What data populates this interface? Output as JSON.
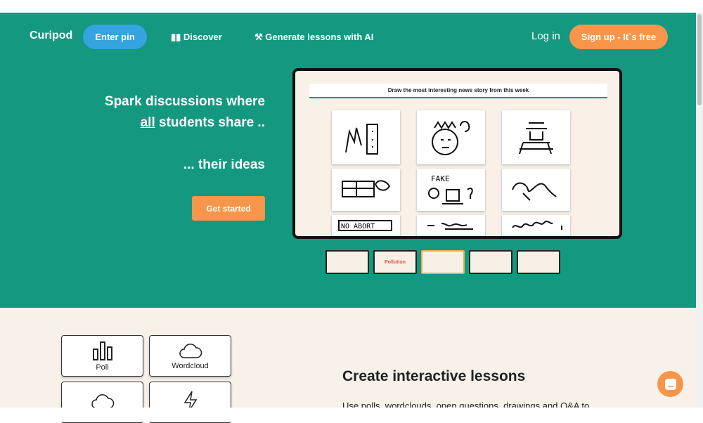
{
  "nav": {
    "logo": "Curipod",
    "enter_pin": "Enter pin",
    "discover": "Discover",
    "generate": "Generate lessons with AI",
    "login": "Log in",
    "signup": "Sign up - It`s free"
  },
  "hero": {
    "line1": "Spark discussions where",
    "line2_em": "all",
    "line2_rest": " students share ..",
    "line3": "... their ideas",
    "cta": "Get started"
  },
  "preview": {
    "prompt": "Draw the most interesting news story from this week",
    "thumbnails": [
      "",
      "Pollution",
      "",
      "",
      ""
    ],
    "active_thumbnail": 2
  },
  "features": {
    "tiles": [
      {
        "label": "Poll",
        "icon": "bar-chart-icon"
      },
      {
        "label": "Wordcloud",
        "icon": "cloud-icon"
      },
      {
        "label": "",
        "icon": "cloud-icon"
      },
      {
        "label": "",
        "icon": "lightning-icon"
      }
    ],
    "heading": "Create interactive lessons",
    "text": "Use polls, wordclouds, open questions, drawings and Q&A to"
  },
  "colors": {
    "brand": "#149880",
    "accent": "#f7964a",
    "pin": "#35a3e0"
  }
}
